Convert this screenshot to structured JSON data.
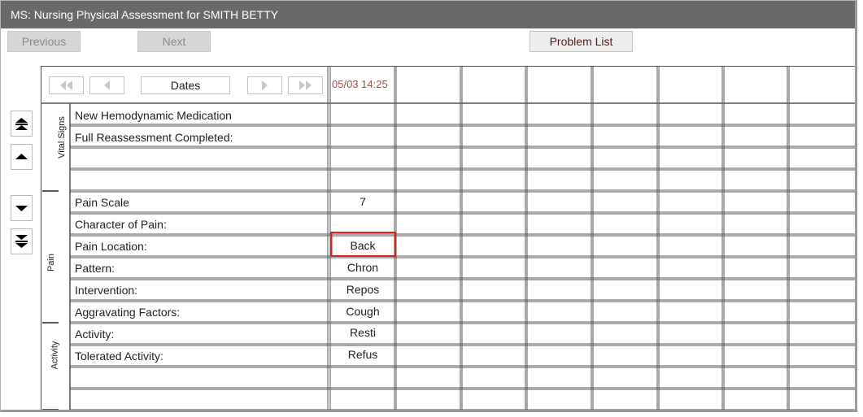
{
  "window": {
    "title": "MS: Nursing Physical Assessment for SMITH BETTY"
  },
  "toolbar": {
    "previous_label": "Previous",
    "next_label": "Next",
    "problem_list_label": "Problem List"
  },
  "grid": {
    "dates_label": "Dates",
    "column_date": "05/03 14:25",
    "sections": [
      {
        "name": "Vital Signs"
      },
      {
        "name": "Pain"
      },
      {
        "name": "Activity"
      }
    ],
    "rows": [
      {
        "label": "New Hemodynamic Medication",
        "value": ""
      },
      {
        "label": "Full Reassessment Completed:",
        "value": ""
      },
      {
        "label": "",
        "value": ""
      },
      {
        "label": "",
        "value": ""
      },
      {
        "label": "Pain Scale",
        "value": "7"
      },
      {
        "label": "Character of Pain:",
        "value": ""
      },
      {
        "label": "Pain Location:",
        "value": "Back"
      },
      {
        "label": "Pattern:",
        "value": "Chron"
      },
      {
        "label": "Intervention:",
        "value": "Repos"
      },
      {
        "label": "Aggravating Factors:",
        "value": "Cough"
      },
      {
        "label": "Activity:",
        "value": "Resti"
      },
      {
        "label": "Tolerated Activity:",
        "value": "Refus"
      },
      {
        "label": "",
        "value": ""
      },
      {
        "label": "",
        "value": ""
      }
    ]
  },
  "colors": {
    "titlebar": "#696969",
    "date_text": "#a0524d",
    "highlight": "#e02020"
  },
  "icons": {
    "nav_first": "double-left-arrow-icon",
    "nav_prev": "left-arrow-icon",
    "nav_next": "right-arrow-icon",
    "nav_last": "double-right-arrow-icon",
    "scroll_top": "double-up-arrow-icon",
    "scroll_up": "up-arrow-icon",
    "scroll_down": "down-arrow-icon",
    "scroll_bottom": "double-down-arrow-icon"
  }
}
